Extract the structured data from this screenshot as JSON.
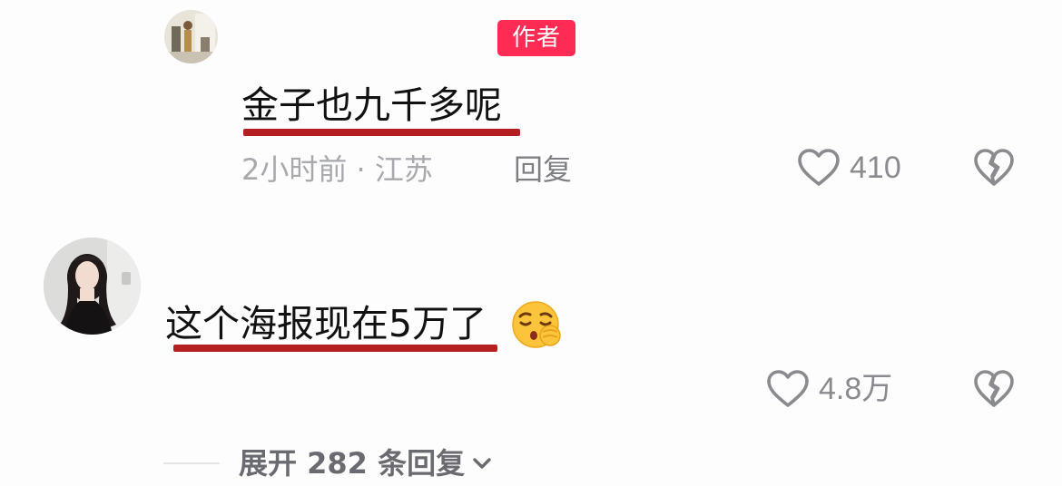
{
  "reply": {
    "author_badge": "作者",
    "text": "金子也九千多呢",
    "meta": "2小时前 · 江苏",
    "reply_label": "回复",
    "like_count": "410"
  },
  "comment": {
    "text": "这个海报现在5万了",
    "emoji_icon": "shushing-face-emoji",
    "like_count": "4.8万"
  },
  "expand": {
    "label": "展开 282 条回复"
  },
  "colors": {
    "author_badge": "#fe2c55",
    "underline": "#b51f22",
    "muted_text": "#a8a9ad",
    "icon_gray": "#8a8b8f"
  }
}
